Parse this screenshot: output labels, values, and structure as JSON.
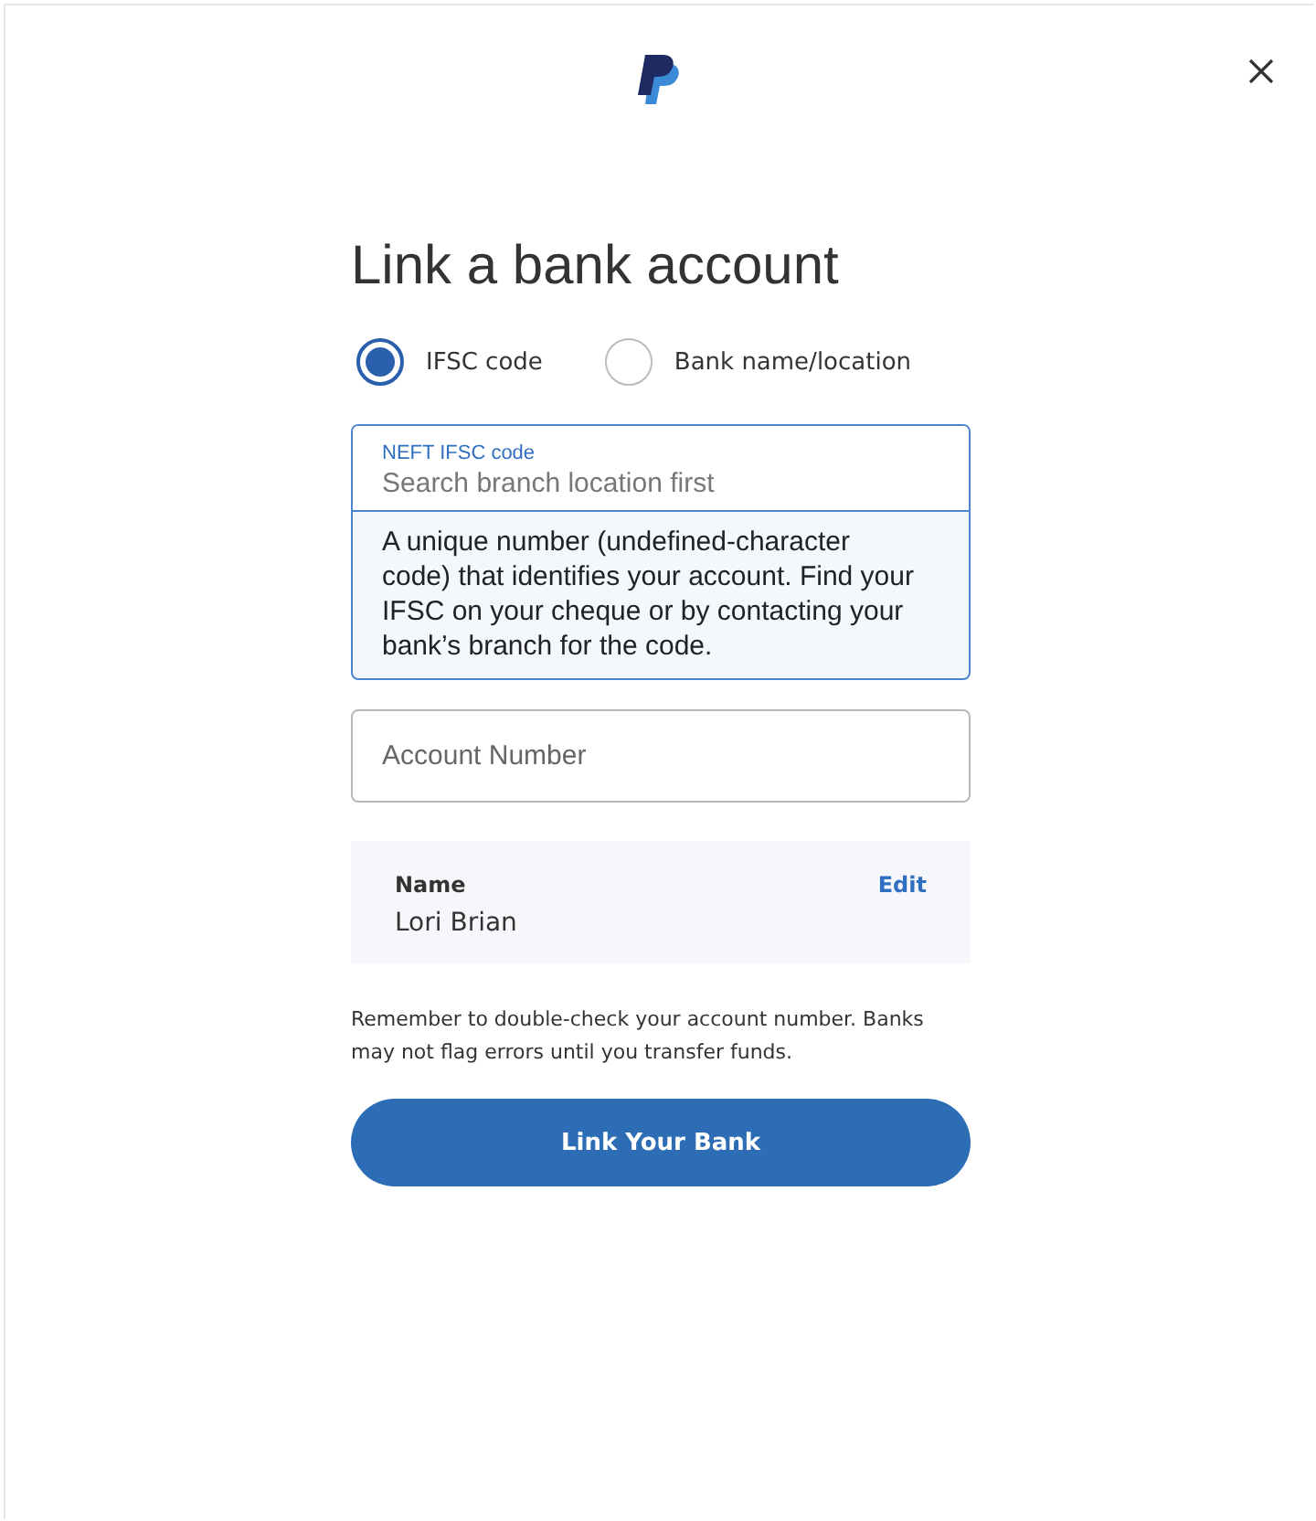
{
  "title": "Link a bank account",
  "search_options": [
    {
      "label": "IFSC code",
      "selected": true
    },
    {
      "label": "Bank name/location",
      "selected": false
    }
  ],
  "ifsc_field": {
    "label": "NEFT IFSC code",
    "placeholder": "Search branch location first",
    "help": "A unique number (undefined-character code) that identifies your account. Find your IFSC on your cheque or by contacting your bank’s branch for the code."
  },
  "account_field": {
    "placeholder": "Account Number"
  },
  "name_card": {
    "label": "Name",
    "value": "Lori Brian",
    "action": "Edit"
  },
  "note": "Remember to double-check your account number. Banks may not flag errors until you transfer funds.",
  "submit_button": "Link Your Bank"
}
